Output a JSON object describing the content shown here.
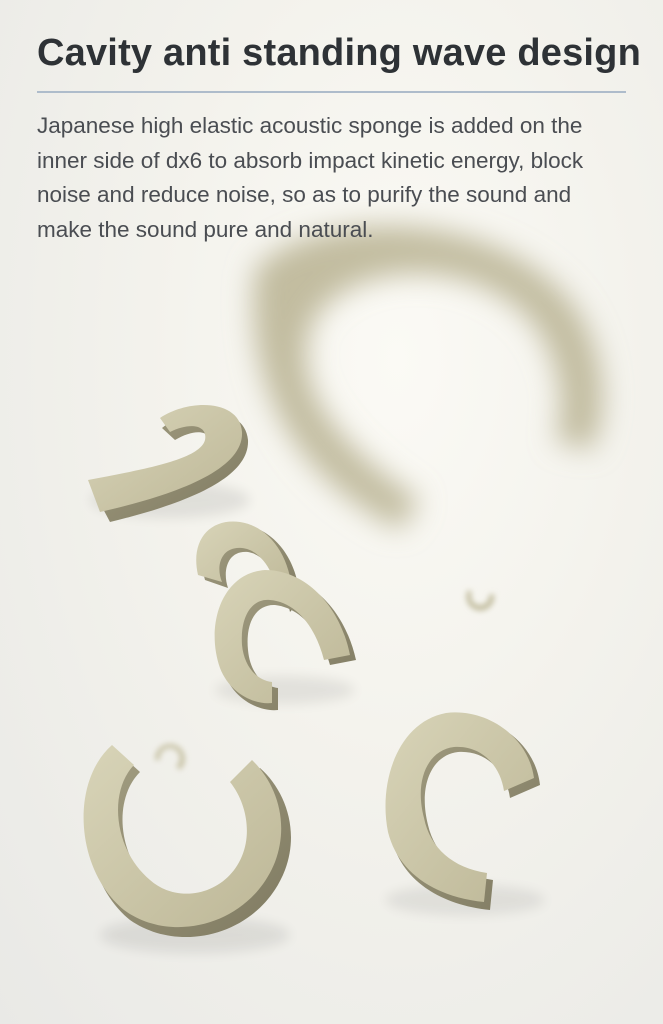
{
  "page": {
    "title": "Cavity anti standing wave design",
    "description": "Japanese high elastic acoustic sponge is added on the inner side of dx6 to absorb impact kinetic energy, block noise and reduce noise, so as to purify the sound and make the sound pure and natural."
  },
  "colors": {
    "title_text": "#2e3236",
    "body_text": "#4a4d52",
    "divider": "#aebccb",
    "ring_face": "#c9c4a6",
    "ring_side": "#8f8a70",
    "background": "#f3f2ec"
  }
}
